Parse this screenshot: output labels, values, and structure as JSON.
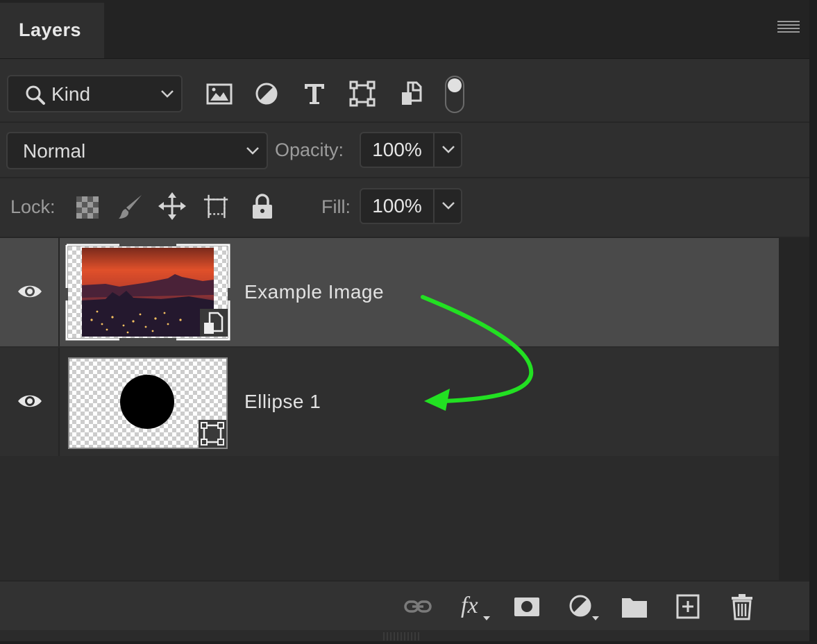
{
  "panel": {
    "tab_label": "Layers",
    "menu_icon": "hamburger-menu-icon"
  },
  "filter": {
    "kind_label": "Kind",
    "kind_icon": "search-icon",
    "icons": [
      "image-filter-icon",
      "adjustment-filter-icon",
      "type-filter-icon",
      "shape-filter-icon",
      "smart-object-filter-icon"
    ],
    "toggle_on": true
  },
  "blend": {
    "mode": "Normal",
    "opacity_label": "Opacity:",
    "opacity_value": "100%"
  },
  "lock": {
    "label": "Lock:",
    "icons": [
      "lock-transparent-pixels-icon",
      "lock-image-pixels-icon",
      "lock-position-icon",
      "lock-artboard-icon",
      "lock-all-icon"
    ],
    "fill_label": "Fill:",
    "fill_value": "100%"
  },
  "layers": [
    {
      "name": "Example Image",
      "visible": true,
      "selected": true,
      "badge": "smart-object-badge-icon"
    },
    {
      "name": "Ellipse 1",
      "visible": true,
      "selected": false,
      "badge": "shape-badge-icon"
    }
  ],
  "bottom_bar": {
    "icons": [
      "link-layers-icon",
      "fx-icon",
      "add-mask-icon",
      "adjustment-layer-icon",
      "new-group-icon",
      "new-layer-icon",
      "delete-icon"
    ],
    "fx_label": "fx"
  },
  "annotation": {
    "arrow_color": "#22e022"
  }
}
